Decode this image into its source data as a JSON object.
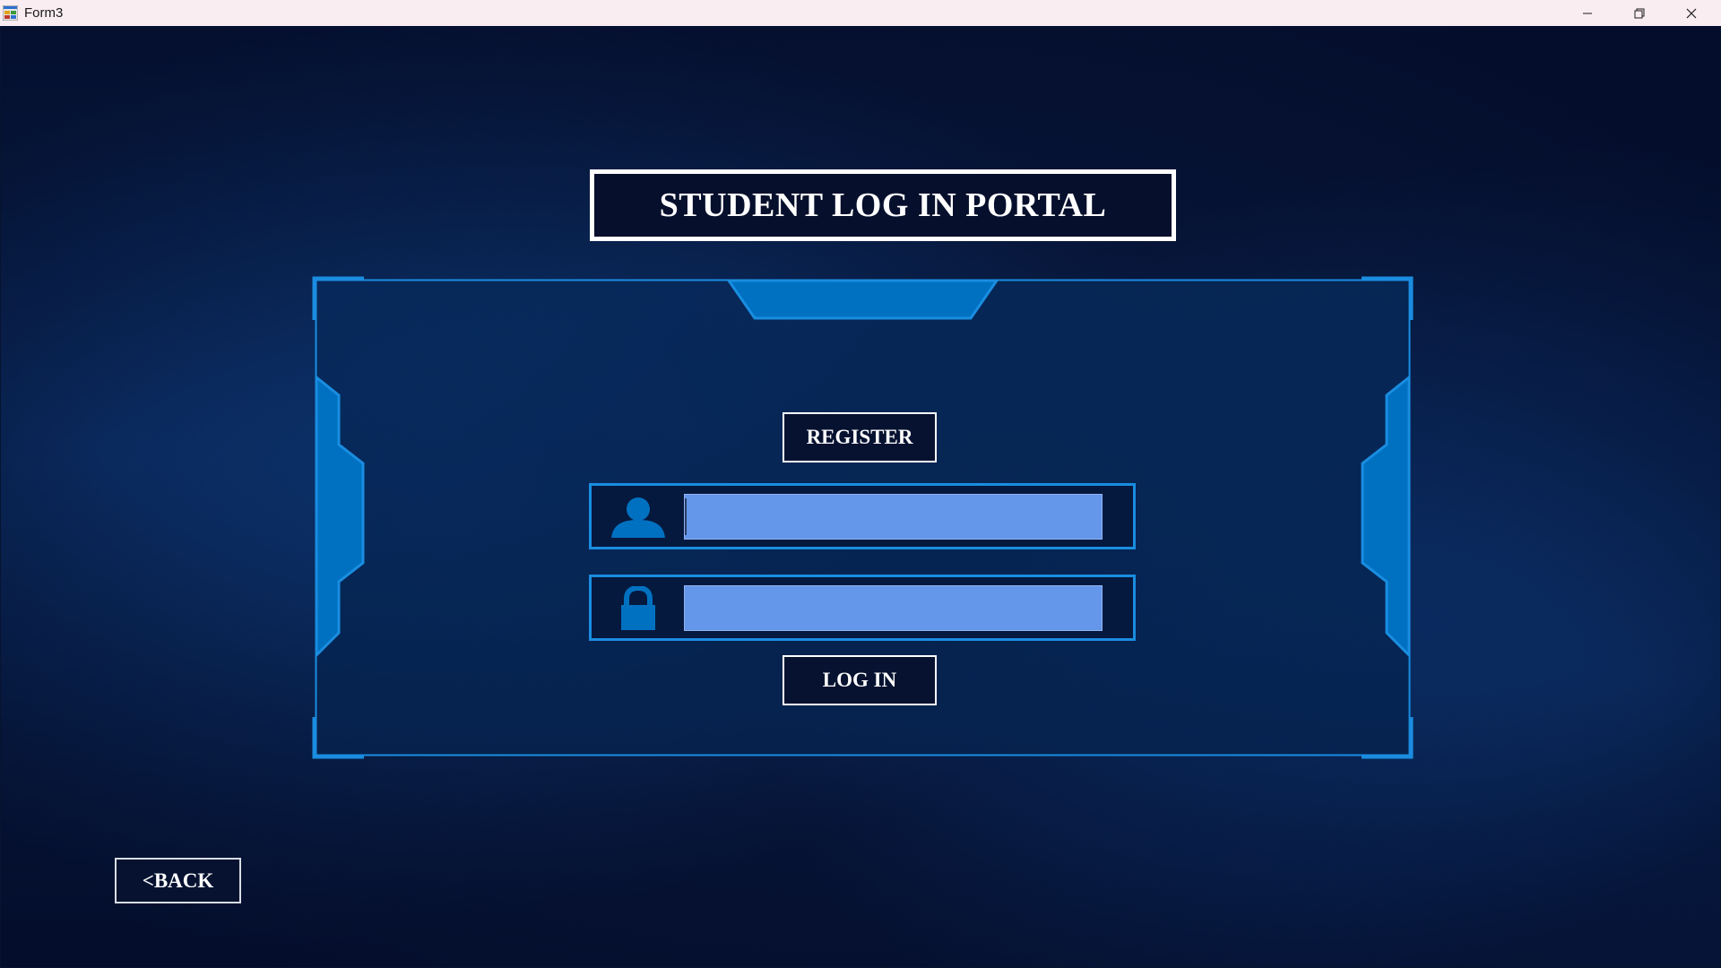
{
  "window": {
    "title": "Form3",
    "minimize_icon": "minimize-icon",
    "restore_icon": "restore-icon",
    "close_icon": "close-icon"
  },
  "header": {
    "title": "STUDENT LOG IN PORTAL"
  },
  "login_panel": {
    "register_label": "REGISTER",
    "username": {
      "value": "",
      "placeholder": "",
      "icon": "user-icon"
    },
    "password": {
      "value": "",
      "placeholder": "",
      "icon": "lock-icon"
    },
    "login_label": "LOG IN"
  },
  "footer": {
    "back_label": "<BACK"
  },
  "colors": {
    "background": "#071538",
    "frame_accent": "#1a8de0",
    "frame_fill": "#0071c1",
    "input_fill": "#6496ea",
    "button_border": "#ffffff",
    "titlebar": "#f9edf2"
  }
}
